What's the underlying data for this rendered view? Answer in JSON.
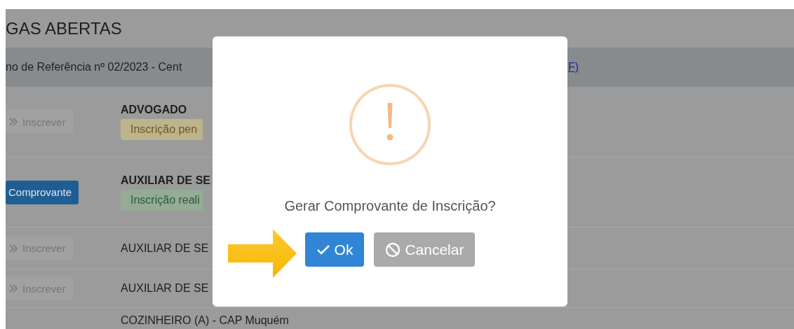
{
  "page": {
    "title": "GAS ABERTAS",
    "notice": {
      "text": "no de Referência nº 02/2023 - Cent",
      "link": "F)"
    },
    "rows": [
      {
        "action": {
          "kind": "subscribe",
          "label": "Inscrever"
        },
        "title": "ADVOGADO",
        "status": {
          "kind": "pending",
          "label": "Inscrição pen"
        }
      },
      {
        "action": {
          "kind": "receipt",
          "label": "Comprovante"
        },
        "title": "AUXILIAR DE SE",
        "status": {
          "kind": "done",
          "label": "Inscrição reali"
        }
      },
      {
        "action": {
          "kind": "subscribe",
          "label": "Inscrever"
        },
        "title": "AUXILIAR DE SE"
      },
      {
        "action": {
          "kind": "subscribe",
          "label": "Inscrever"
        },
        "title": "AUXILIAR DE SE"
      },
      {
        "title": "COZINHEIRO (A) - CAP Muquém"
      }
    ]
  },
  "dialog": {
    "message": "Gerar Comprovante de Inscrição?",
    "confirm": "Ok",
    "cancel": "Cancelar"
  }
}
